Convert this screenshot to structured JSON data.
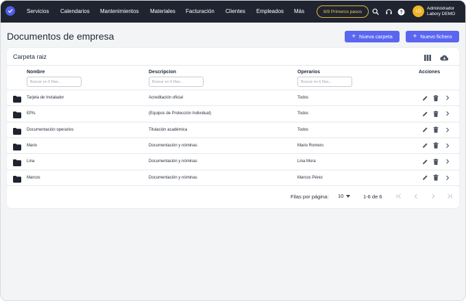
{
  "nav": {
    "items": [
      "Servicios",
      "Calendarios",
      "Mantenimientos",
      "Materiales",
      "Facturación",
      "Clientes",
      "Empleados",
      "Más"
    ],
    "steps_badge": "8/9 Primeros pasos",
    "user": {
      "initials": "LD",
      "line1": "Administrador",
      "line2": "Labory DEMO"
    }
  },
  "page": {
    "title": "Documentos de empresa",
    "new_folder": "Nueva carpeta",
    "new_file": "Nuevo fichero"
  },
  "card": {
    "title": "Carpeta raiz",
    "columns": {
      "name": "Nombre",
      "description": "Descripcion",
      "operators": "Operarios",
      "actions": "Acciones"
    },
    "filter_placeholder": "Buscar en 6 filas...",
    "rows": [
      {
        "name": "Tarjeta de Instalador",
        "description": "Acreditación oficial",
        "operators": "Todos"
      },
      {
        "name": "EPIs",
        "description": "(Equipos de Protección Individual)",
        "operators": "Todos"
      },
      {
        "name": "Documentación operarios",
        "description": "Titulación académica",
        "operators": "Todos"
      },
      {
        "name": "Mario",
        "description": "Documentación y nóminas",
        "operators": "Mario Romero"
      },
      {
        "name": "Lina",
        "description": "Documentación y nóminas",
        "operators": "Lina Mora"
      },
      {
        "name": "Marcos",
        "description": "Documentación y nóminas",
        "operators": "Marcos Pérez"
      }
    ],
    "pagination": {
      "rows_per_page_label": "Filas por página:",
      "rows_per_page": "10",
      "range": "1-6 de 6"
    }
  },
  "colors": {
    "topbar": "#1f2430",
    "accent": "#5b66f0",
    "badge": "#e2b93b",
    "avatar": "#f0b429"
  }
}
